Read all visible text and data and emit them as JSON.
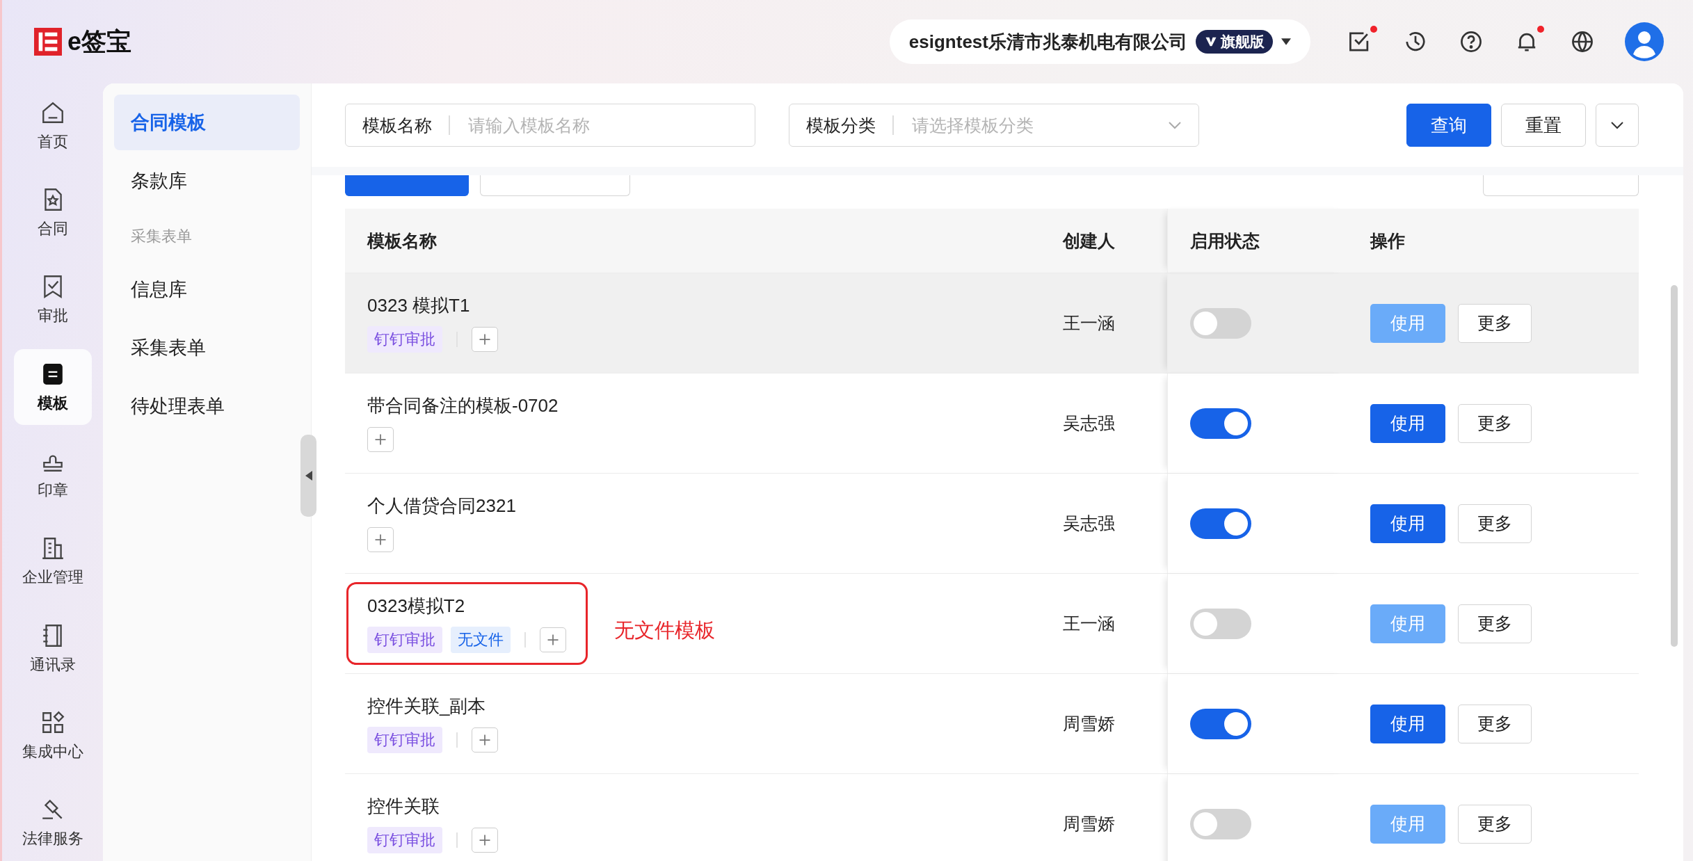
{
  "header": {
    "brand": "e签宝",
    "company": "esigntest乐清市兆泰机电有限公司",
    "edition": "旗舰版",
    "icons": [
      {
        "kind": "todo",
        "badge": true
      },
      {
        "kind": "history",
        "badge": false
      },
      {
        "kind": "help",
        "badge": false
      },
      {
        "kind": "bell",
        "badge": true
      },
      {
        "kind": "globe",
        "badge": false
      }
    ]
  },
  "nav": [
    {
      "label": "首页",
      "kind": "home",
      "selected": false
    },
    {
      "label": "合同",
      "kind": "contract",
      "selected": false
    },
    {
      "label": "审批",
      "kind": "approval",
      "selected": false
    },
    {
      "label": "模板",
      "kind": "template",
      "selected": true
    },
    {
      "label": "印章",
      "kind": "seal",
      "selected": false
    },
    {
      "label": "企业管理",
      "kind": "company",
      "selected": false
    },
    {
      "label": "通讯录",
      "kind": "contacts",
      "selected": false
    },
    {
      "label": "集成中心",
      "kind": "apps",
      "selected": false
    },
    {
      "label": "法律服务",
      "kind": "legal",
      "selected": false
    }
  ],
  "subnav": {
    "items": [
      {
        "label": "合同模板",
        "selected": true
      },
      {
        "label": "条款库",
        "selected": false
      }
    ],
    "group_label": "采集表单",
    "group_items": [
      {
        "label": "信息库",
        "selected": false
      },
      {
        "label": "采集表单",
        "selected": false
      },
      {
        "label": "待处理表单",
        "selected": false
      }
    ]
  },
  "filters": [
    {
      "label": "模板名称",
      "placeholder": "请输入模板名称",
      "kind": "input"
    },
    {
      "label": "模板分类",
      "placeholder": "请选择模板分类",
      "kind": "select"
    }
  ],
  "filter_buttons": {
    "query": "查询",
    "reset": "重置"
  },
  "table": {
    "columns": [
      "模板名称",
      "创建人",
      "启用状态",
      "操作"
    ],
    "rows": [
      {
        "name": "0323 模拟T1",
        "tags": [
          {
            "label": "钉钉审批",
            "kind": "approval"
          }
        ],
        "creator": "王一涵",
        "enabled": false,
        "highlighted": true,
        "use": "使用",
        "more": "更多"
      },
      {
        "name": "带合同备注的模板-0702",
        "tags": [],
        "creator": "吴志强",
        "enabled": true,
        "highlighted": false,
        "use": "使用",
        "more": "更多"
      },
      {
        "name": "个人借贷合同2321",
        "tags": [],
        "creator": "吴志强",
        "enabled": true,
        "highlighted": false,
        "use": "使用",
        "more": "更多"
      },
      {
        "name": "0323模拟T2",
        "tags": [
          {
            "label": "钉钉审批",
            "kind": "approval"
          },
          {
            "label": "无文件",
            "kind": "nofile"
          }
        ],
        "creator": "王一涵",
        "enabled": false,
        "highlighted": false,
        "use": "使用",
        "more": "更多",
        "note": "无文件模板"
      },
      {
        "name": "控件关联_副本",
        "tags": [
          {
            "label": "钉钉审批",
            "kind": "approval"
          }
        ],
        "creator": "周雪娇",
        "enabled": true,
        "highlighted": false,
        "use": "使用",
        "more": "更多"
      },
      {
        "name": "控件关联",
        "tags": [
          {
            "label": "钉钉审批",
            "kind": "approval"
          }
        ],
        "creator": "周雪娇",
        "enabled": false,
        "highlighted": false,
        "use": "使用",
        "more": "更多"
      }
    ]
  }
}
